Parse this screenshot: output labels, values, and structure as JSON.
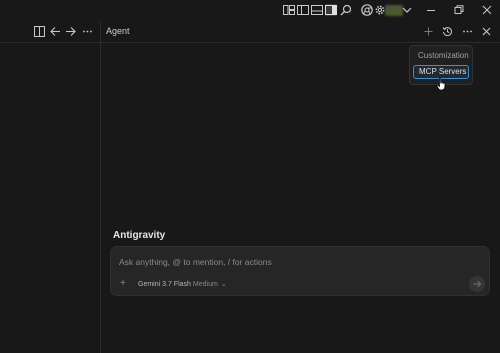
{
  "titlebar": {
    "icons": [
      "toggle-panel-icon",
      "sidebar-left-icon",
      "panel-bottom-icon",
      "sidebar-right-icon",
      "search-icon",
      "chrome-icon",
      "settings-icon",
      "account-chevron-icon",
      "minimize-icon",
      "restore-icon",
      "close-icon"
    ]
  },
  "left_toolbar": {
    "icons": [
      "split-editor-icon",
      "back-arrow-icon",
      "forward-arrow-icon",
      "more-icon"
    ]
  },
  "agent_panel": {
    "title": "Agent",
    "header_icons": [
      "new-chat-plus-icon",
      "history-icon",
      "more-icon",
      "close-icon"
    ],
    "menu": {
      "items": [
        "Customization",
        "MCP Servers"
      ],
      "selected": "MCP Servers"
    },
    "section_title": "Antigravity",
    "chat": {
      "placeholder": "Ask anything, @ to mention, / for actions",
      "value": "",
      "add_symbol": "+",
      "model_name": "Gemini 3.7 Flash",
      "model_variant": "Medium"
    }
  },
  "colors": {
    "background": "#181818",
    "border": "#2b2b2b",
    "input_bg": "#262626",
    "accent": "#3b8ed0"
  }
}
